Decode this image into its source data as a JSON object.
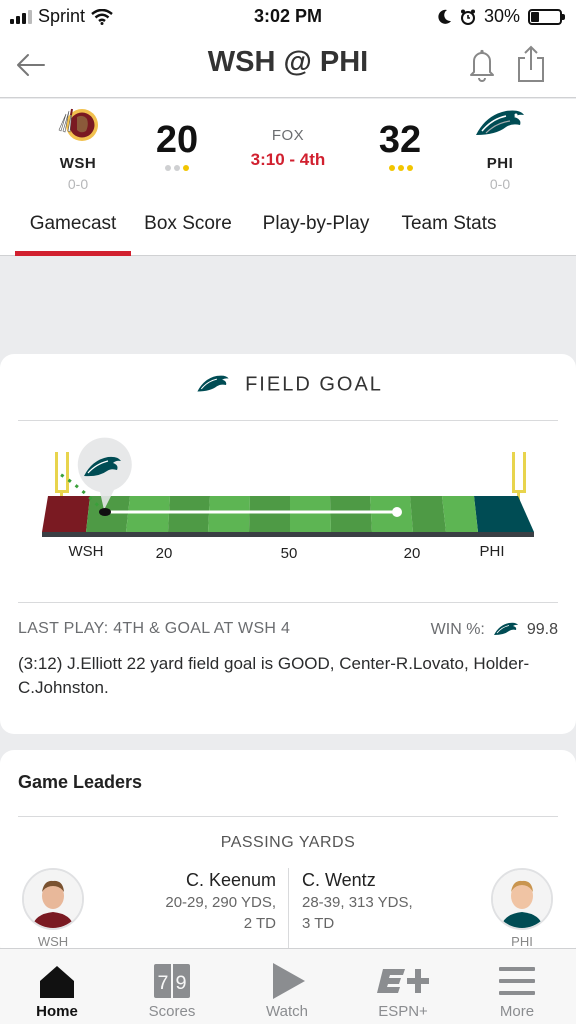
{
  "status_bar": {
    "carrier": "Sprint",
    "time": "3:02 PM",
    "battery": "30%",
    "battery_level": 0.3
  },
  "header": {
    "title": "WSH @ PHI"
  },
  "game": {
    "away": {
      "abbr": "WSH",
      "record": "0-0",
      "score": "20",
      "timeouts_used": 2,
      "timeouts_total": 3,
      "color": "#7a1a22"
    },
    "home": {
      "abbr": "PHI",
      "record": "0-0",
      "score": "32",
      "timeouts_used": 0,
      "timeouts_total": 3,
      "color": "#004c54"
    },
    "network": "FOX",
    "clock": "3:10 - 4th"
  },
  "tabs": [
    {
      "label": "Gamecast",
      "active": true
    },
    {
      "label": "Box Score",
      "active": false
    },
    {
      "label": "Play-by-Play",
      "active": false
    },
    {
      "label": "Team Stats",
      "active": false
    }
  ],
  "play_card": {
    "title": "FIELD GOAL",
    "field_labels": {
      "left_team": "WSH",
      "right_team": "PHI",
      "yard_left": "20",
      "yard_mid": "50",
      "yard_right": "20"
    },
    "last_play": "LAST PLAY: 4TH & GOAL AT WSH 4",
    "win_label": "WIN %:",
    "win_value": "99.8",
    "description": "(3:12) J.Elliott 22 yard field goal is GOOD, Center-R.Lovato, Holder-C.Johnston."
  },
  "leaders": {
    "title": "Game Leaders",
    "category": "PASSING YARDS",
    "away": {
      "name": "C. Keenum",
      "stat_line1": "20-29, 290 YDS,",
      "stat_line2": "2 TD",
      "team": "WSH"
    },
    "home": {
      "name": "C. Wentz",
      "stat_line1": "28-39, 313 YDS,",
      "stat_line2": "3 TD",
      "team": "PHI"
    }
  },
  "bottom_nav": [
    {
      "label": "Home",
      "icon": "home-icon",
      "active": true
    },
    {
      "label": "Scores",
      "icon": "scores-icon",
      "active": false
    },
    {
      "label": "Watch",
      "icon": "play-icon",
      "active": false
    },
    {
      "label": "ESPN+",
      "icon": "espn-plus-icon",
      "active": false
    },
    {
      "label": "More",
      "icon": "menu-icon",
      "active": false
    }
  ],
  "colors": {
    "accent": "#d1202f",
    "field_green": "#5aa94f",
    "timeout_yellow": "#f2c500",
    "timeout_grey": "#cfd0d2"
  }
}
